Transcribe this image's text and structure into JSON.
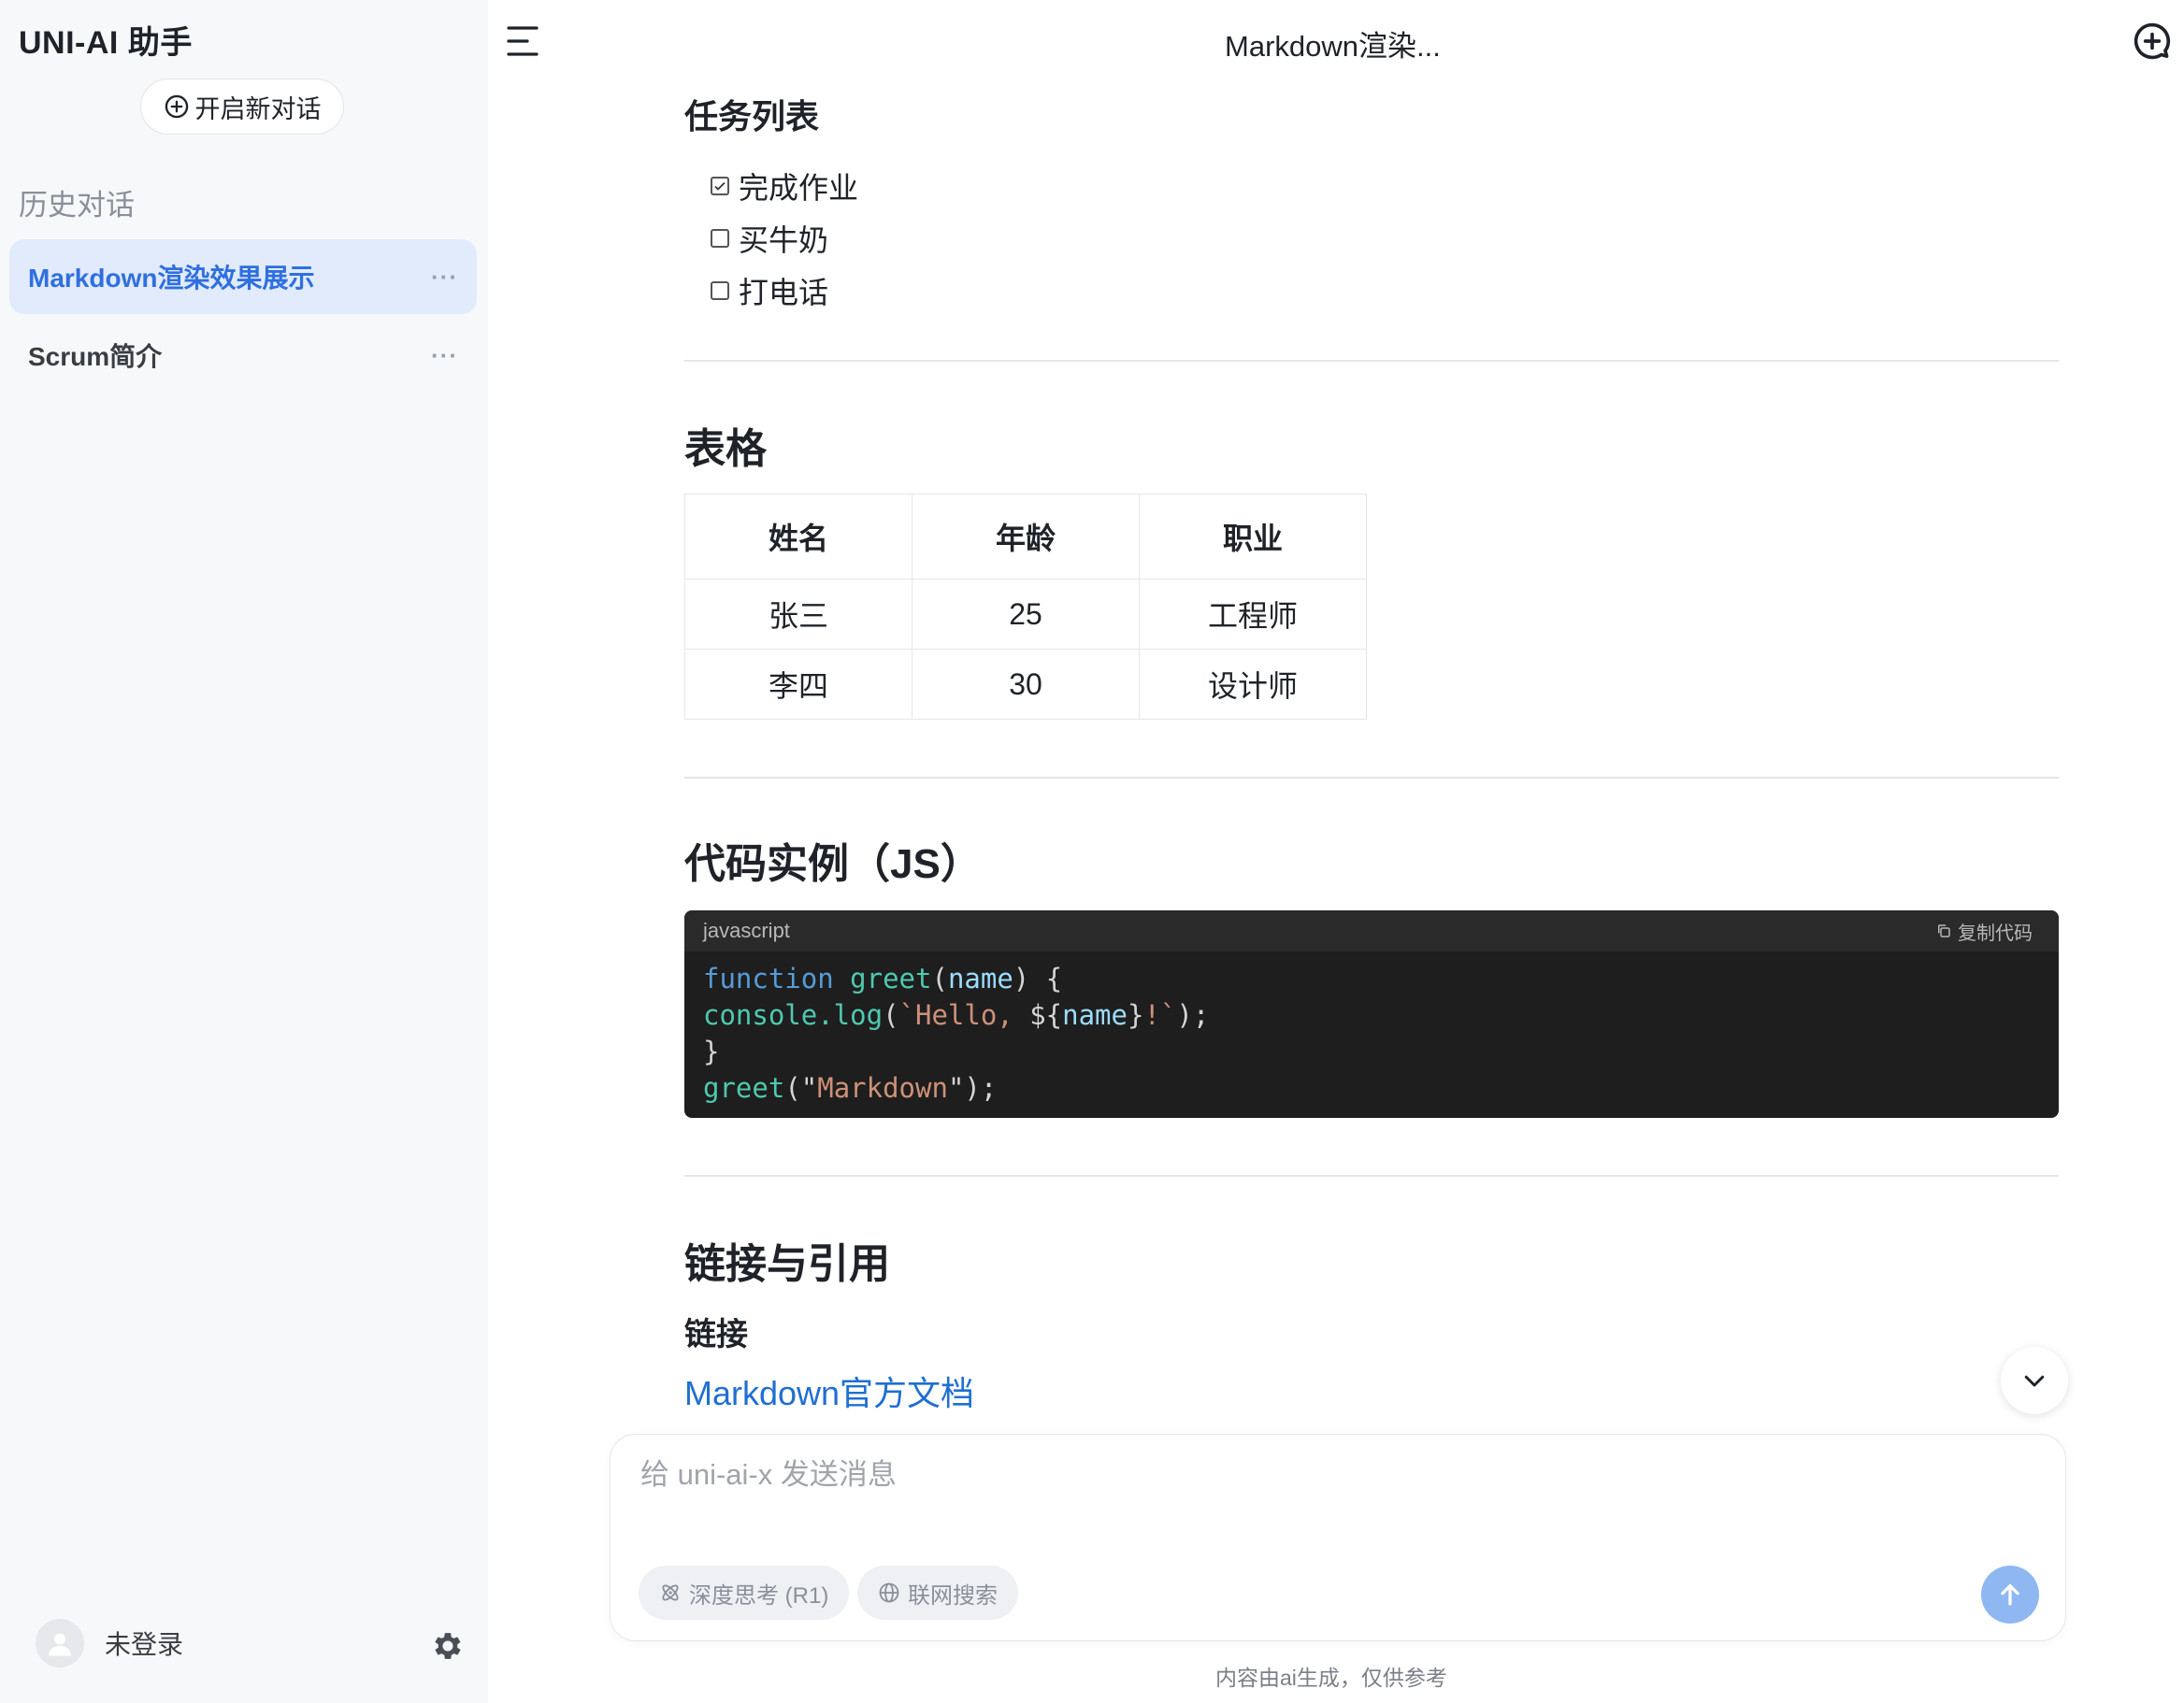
{
  "sidebar": {
    "brand": "UNI-AI 助手",
    "new_chat_label": "开启新对话",
    "history_title": "历史对话",
    "items": [
      {
        "label": "Markdown渲染效果展示",
        "more": "···"
      },
      {
        "label": "Scrum简介",
        "more": "···"
      }
    ],
    "user_label": "未登录"
  },
  "header": {
    "title": "Markdown渲染..."
  },
  "content": {
    "task_heading": "任务列表",
    "tasks": [
      {
        "label": "完成作业",
        "checked": true
      },
      {
        "label": "买牛奶",
        "checked": false
      },
      {
        "label": "打电话",
        "checked": false
      }
    ],
    "table_heading": "表格",
    "table": {
      "headers": [
        "姓名",
        "年龄",
        "职业"
      ],
      "rows": [
        [
          "张三",
          "25",
          "工程师"
        ],
        [
          "李四",
          "30",
          "设计师"
        ]
      ]
    },
    "code_heading": "代码实例（JS）",
    "code": {
      "language": "javascript",
      "copy_label": "复制代码",
      "lines": [
        "function greet(name) {",
        "console.log(`Hello, ${name}!`);",
        "}",
        "greet(\"Markdown\");"
      ]
    },
    "links_heading": "链接与引用",
    "links_subheading": "链接",
    "link_text": "Markdown官方文档"
  },
  "composer": {
    "placeholder": "给 uni-ai-x 发送消息",
    "deep_think_label": "深度思考 (R1)",
    "web_search_label": "联网搜索"
  },
  "footer_note": "内容由ai生成，仅供参考",
  "colors": {
    "accent": "#2f6fe0",
    "active_bg": "#e1ebfb",
    "send_button": "#8fb7f2",
    "link": "#1f6fd1",
    "code_bg": "#1e1e1e"
  }
}
